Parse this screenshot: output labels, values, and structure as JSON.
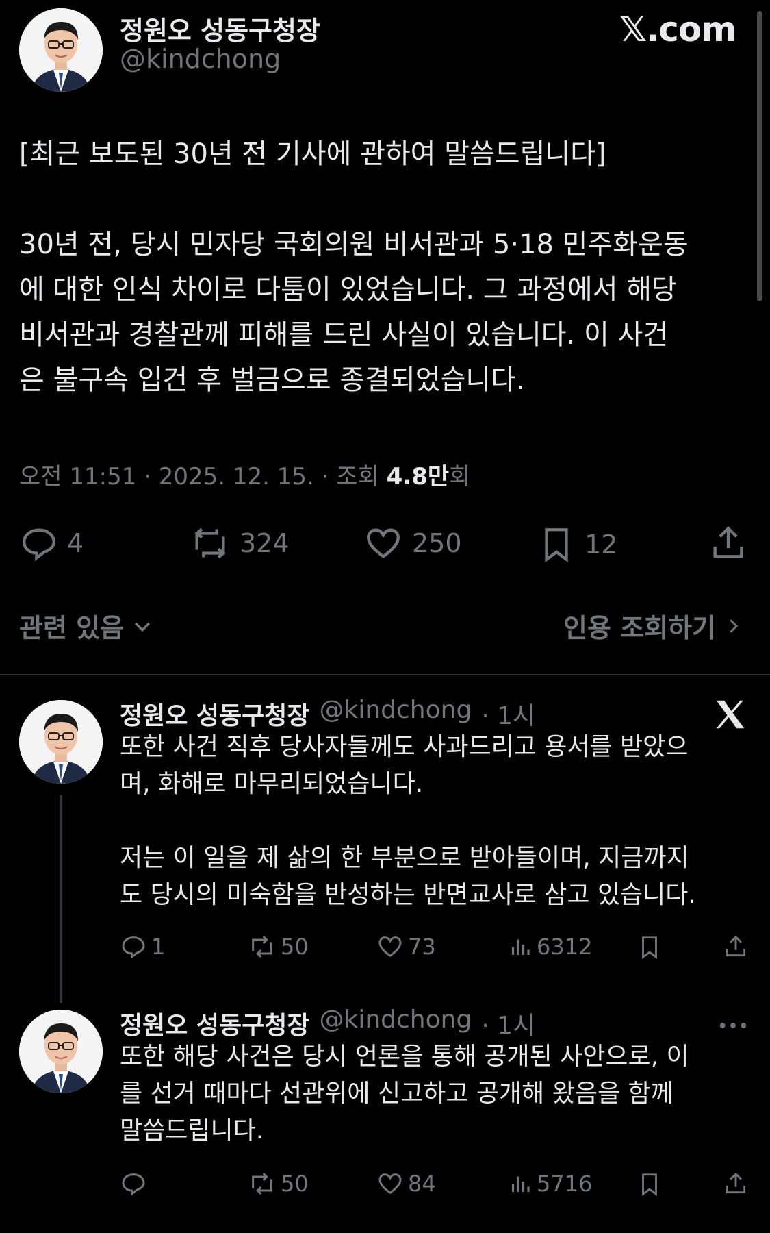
{
  "main_tweet": {
    "author_name": "정원오 성동구청장",
    "author_handle": "@kindchong",
    "brand": "𝕏.com",
    "text_lines": [
      "[최근 보도된 30년 전 기사에 관하여 말씀드립니다]",
      "",
      "30년 전, 당시 민자당 국회의원 비서관과 5·18 민주화운동",
      "에 대한 인식 차이로 다툼이 있었습니다. 그 과정에서 해당",
      "비서관과 경찰관께 피해를 드린 사실이 있습니다. 이 사건",
      "은 불구속 입건 후 벌금으로 종결되었습니다."
    ],
    "meta_time": "오전 11:51 · 2025. 12. 15. · 조회 ",
    "meta_views": "4.8만",
    "meta_views_suffix": "회",
    "actions": {
      "replies": "4",
      "retweets": "324",
      "likes": "250",
      "bookmarks": "12"
    },
    "related_label": "관련 있음",
    "quotes_label": "인용 조회하기"
  },
  "replies": [
    {
      "author_name": "정원오 성동구청장",
      "author_handle": "@kindchong",
      "time": "· 1시",
      "corner_icon": "x-logo-icon",
      "text_lines": [
        "또한 사건 직후 당사자들께도 사과드리고 용서를 받았으",
        "며, 화해로 마무리되었습니다.",
        "",
        "저는 이 일을 제 삶의 한 부분으로 받아들이며, 지금까지",
        "도 당시의 미숙함을 반성하는 반면교사로 삼고 있습니다."
      ],
      "replies": "1",
      "retweets": "50",
      "likes": "73",
      "views": "6312"
    },
    {
      "author_name": "정원오 성동구청장",
      "author_handle": "@kindchong",
      "time": "· 1시",
      "corner_icon": "more-icon",
      "text_lines": [
        "또한 해당 사건은 당시 언론을 통해 공개된 사안으로, 이",
        "를 선거 때마다 선관위에 신고하고 공개해 왔음을 함께",
        "말씀드립니다."
      ],
      "replies": "",
      "retweets": "50",
      "likes": "84",
      "views": "5716"
    }
  ],
  "colors": {
    "background": "#000000",
    "text_primary": "#e7e9ea",
    "text_secondary": "#71767b",
    "divider": "#2f3336"
  }
}
